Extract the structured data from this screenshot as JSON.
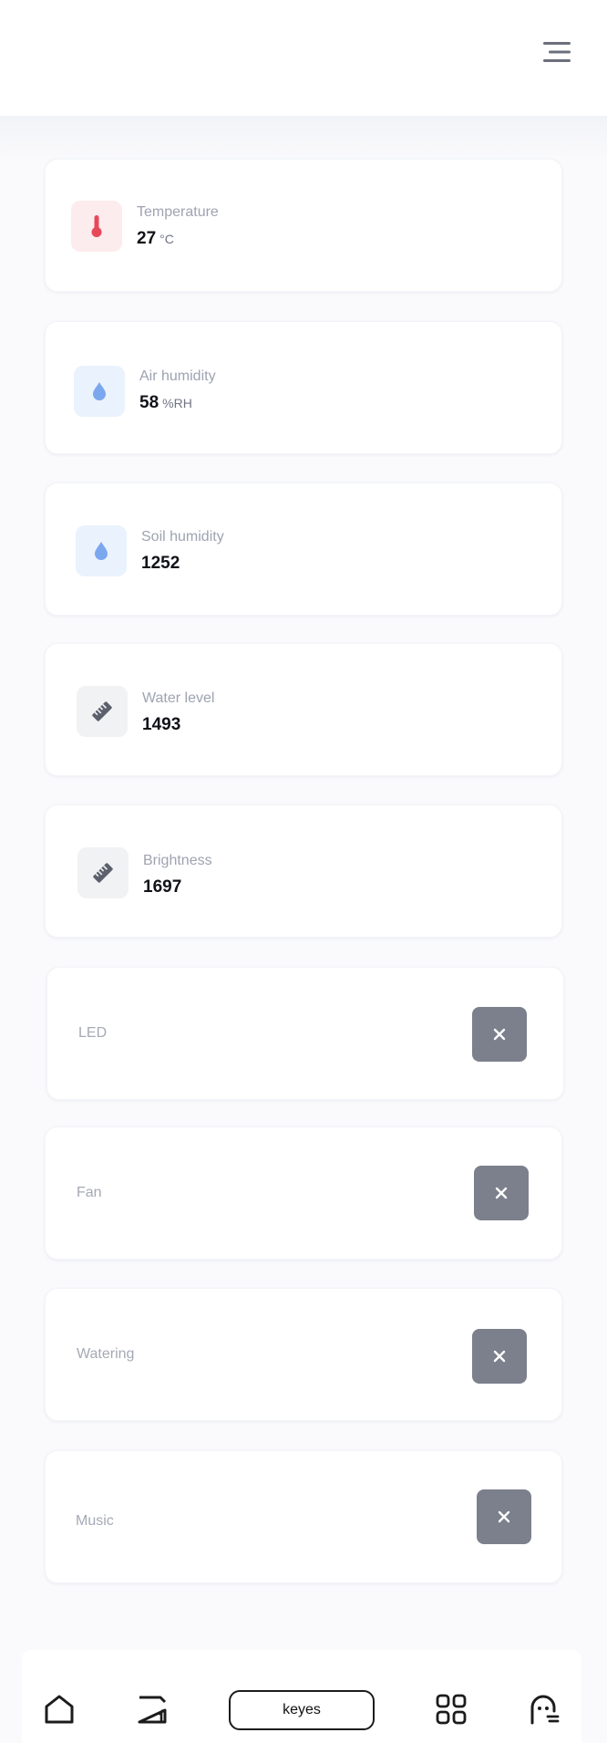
{
  "header": {
    "menu_icon": "hamburger-menu-icon"
  },
  "sensors": [
    {
      "label": "Temperature",
      "value": "27",
      "unit": "°C",
      "icon": "thermometer-icon",
      "tile_color": "#fdeced"
    },
    {
      "label": "Air humidity",
      "value": "58",
      "unit": "%RH",
      "icon": "water-drop-icon",
      "tile_color": "#eaf2fd"
    },
    {
      "label": "Soil humidity",
      "value": "1252",
      "unit": "",
      "icon": "water-drop-icon",
      "tile_color": "#eaf2fd"
    },
    {
      "label": "Water level",
      "value": "1493",
      "unit": "",
      "icon": "ruler-icon",
      "tile_color": "#f1f2f4"
    },
    {
      "label": "Brightness",
      "value": "1697",
      "unit": "",
      "icon": "ruler-icon",
      "tile_color": "#f1f2f4"
    }
  ],
  "controls": [
    {
      "label": "LED",
      "state_icon": "close-icon"
    },
    {
      "label": "Fan",
      "state_icon": "close-icon"
    },
    {
      "label": "Watering",
      "state_icon": "close-icon"
    },
    {
      "label": "Music",
      "state_icon": "close-icon"
    }
  ],
  "nav": {
    "items": [
      "home-icon",
      "device-icon",
      "apps-icon",
      "profile-icon"
    ],
    "center_label": "keyes"
  },
  "colors": {
    "thermometer": "#e8475a",
    "drop": "#7ba7ee",
    "ruler": "#5b606c",
    "toggle_off": "#7b808c"
  }
}
